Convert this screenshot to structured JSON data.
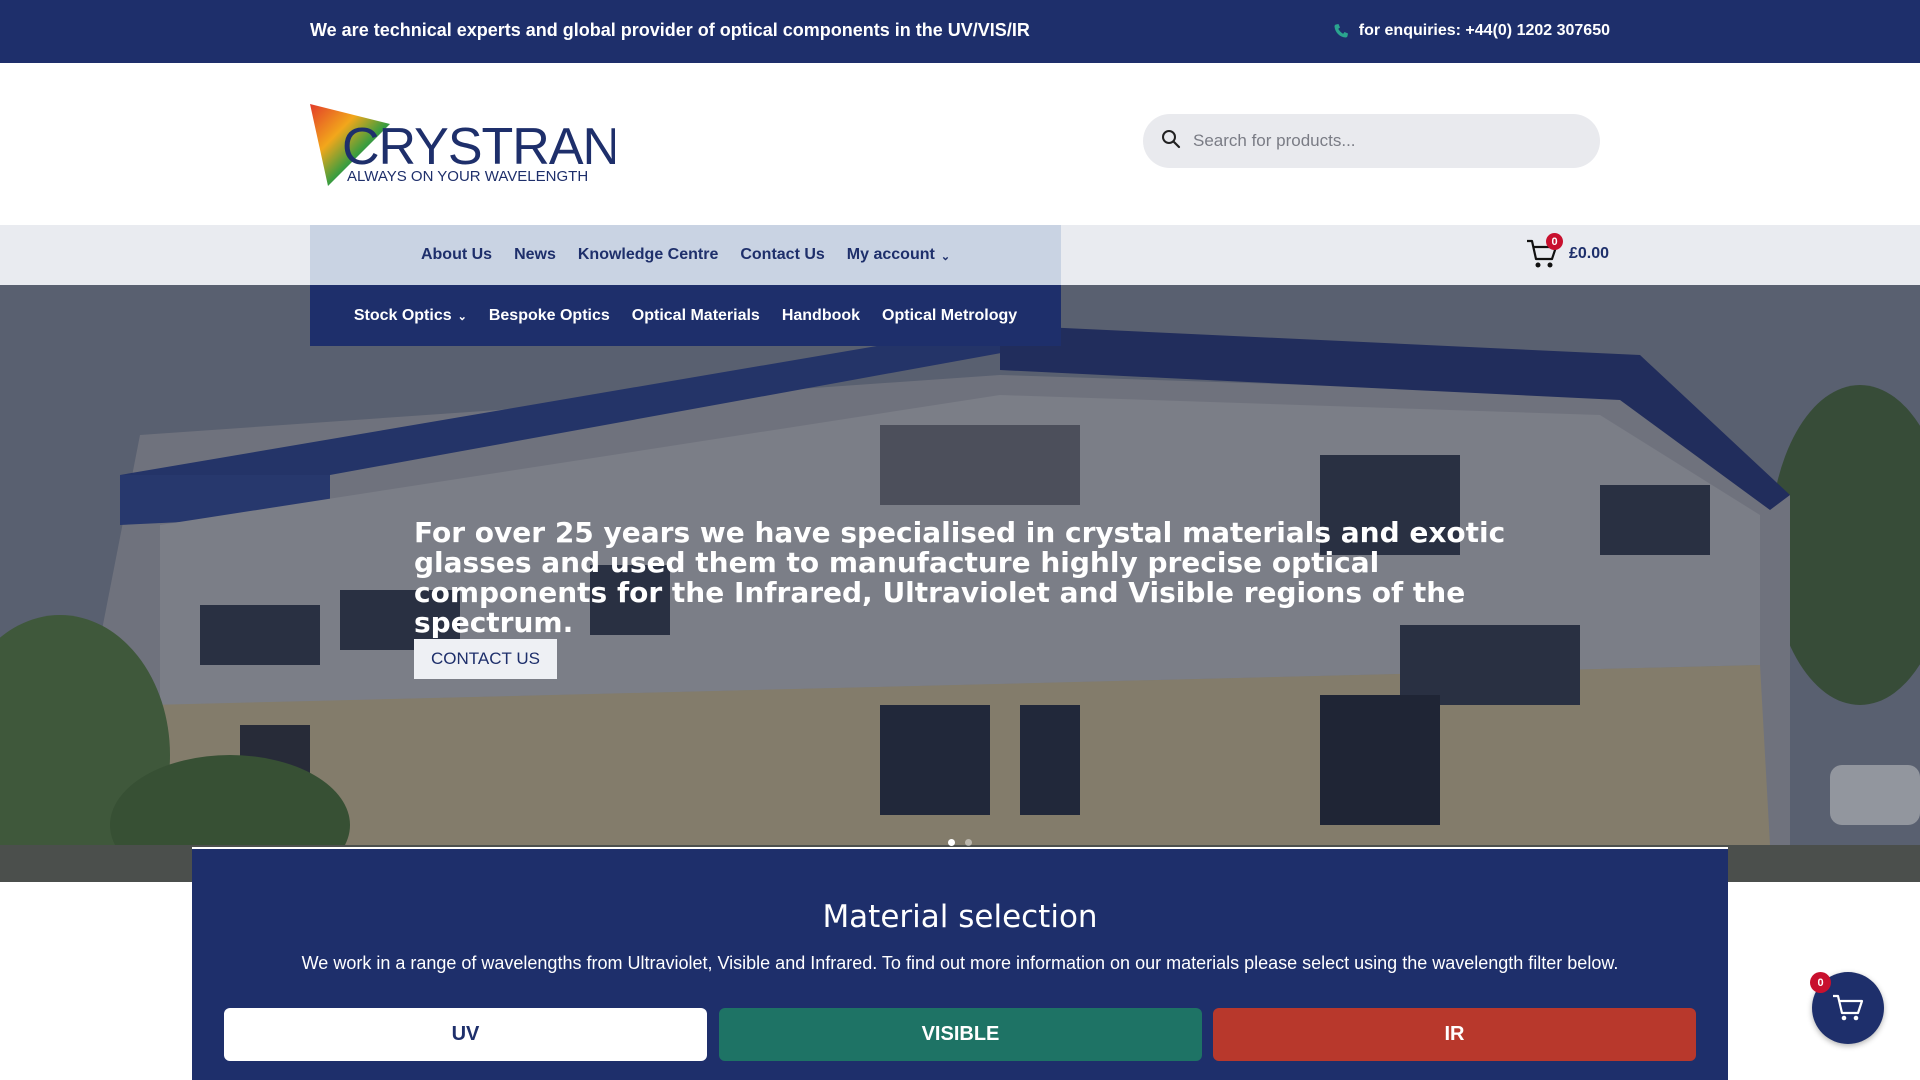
{
  "topbar": {
    "message": "We are technical experts and global provider of optical components in the UV/VIS/IR",
    "phone": "for enquiries: +44(0) 1202 307650",
    "phone_icon": "phone-icon"
  },
  "header": {
    "logo_name": "CRYSTRAN",
    "logo_tagline": "ALWAYS ON YOUR WAVELENGTH",
    "search_placeholder": "Search for products...",
    "search_icon": "search-icon"
  },
  "nav_primary": [
    {
      "label": "About Us"
    },
    {
      "label": "News"
    },
    {
      "label": "Knowledge Centre"
    },
    {
      "label": "Contact Us"
    },
    {
      "label": "My account"
    }
  ],
  "nav_secondary": [
    {
      "label": "Stock Optics"
    },
    {
      "label": "Bespoke Optics"
    },
    {
      "label": "Optical Materials"
    },
    {
      "label": "Handbook"
    },
    {
      "label": "Optical Metrology"
    }
  ],
  "cart": {
    "count": "0",
    "total": "£0.00",
    "icon": "cart-icon"
  },
  "hero": {
    "text": "For over 25 years we have specialised in crystal materials and exotic glasses and used them to manufacture highly precise optical components for the Infrared, Ultraviolet and Visible regions of the spectrum.",
    "button": "CONTACT US",
    "slides": 2,
    "active_slide": 1
  },
  "material": {
    "title": "Material selection",
    "description": "We work in a range of wavelengths from Ultraviolet, Visible and Infrared. To find out more information on our materials please select using the wavelength filter below.",
    "filters": [
      {
        "label": "UV",
        "color": "#ffffff"
      },
      {
        "label": "VISIBLE",
        "color": "#1e7365"
      },
      {
        "label": "IR",
        "color": "#b8382c"
      }
    ]
  },
  "float_cart": {
    "count": "0"
  },
  "colors": {
    "brand": "#1e2f6b",
    "accent_red": "#c8102e"
  }
}
